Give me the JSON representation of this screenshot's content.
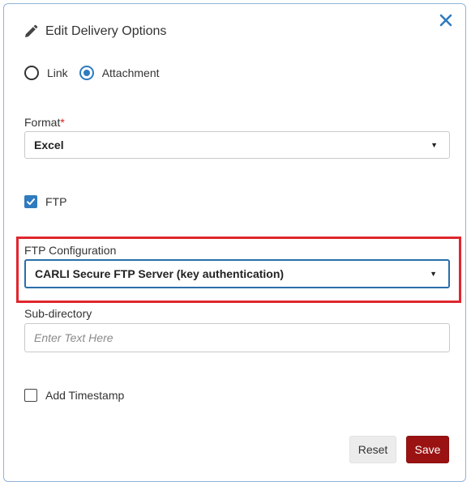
{
  "dialog": {
    "title": "Edit Delivery Options",
    "title_icon": "pencil-icon",
    "close_icon": "close-icon"
  },
  "delivery_type": {
    "options": [
      "Link",
      "Attachment"
    ],
    "selected": "Attachment"
  },
  "format": {
    "label": "Format",
    "required_mark": "*",
    "value": "Excel"
  },
  "ftp": {
    "label": "FTP",
    "checked": true
  },
  "ftp_configuration": {
    "label": "FTP Configuration",
    "value": "CARLI Secure FTP Server (key authentication)"
  },
  "sub_directory": {
    "label": "Sub-directory",
    "placeholder": "Enter Text Here",
    "value": ""
  },
  "add_timestamp": {
    "label": "Add Timestamp",
    "checked": false
  },
  "buttons": {
    "reset": "Reset",
    "save": "Save"
  },
  "colors": {
    "accent": "#2f7bbf",
    "save_button": "#9b1212",
    "highlight": "#e0262d",
    "required": "#d21f1f"
  }
}
